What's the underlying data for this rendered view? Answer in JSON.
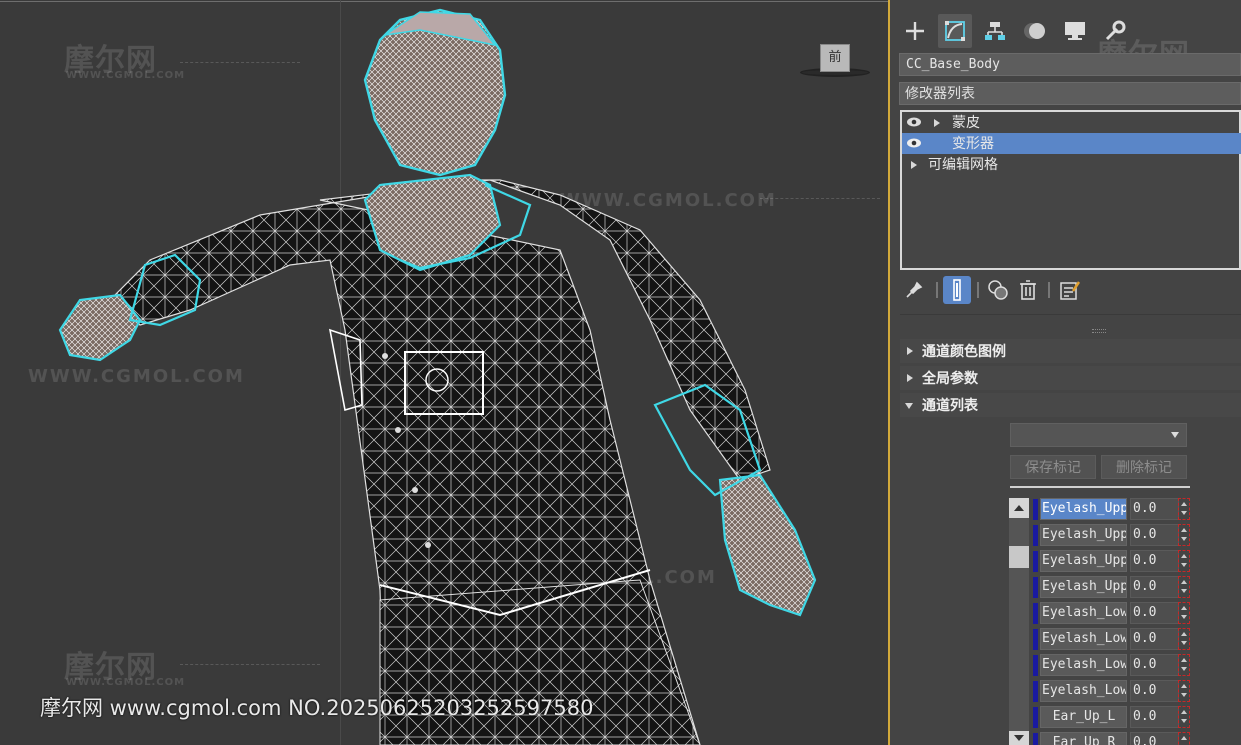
{
  "viewport": {
    "label": "前",
    "watermark_logo": "摩尔网",
    "watermark_sub": "WWW.CGMOL.COM",
    "watermark_url": "WWW.CGMOL.COM",
    "footer_text": "摩尔网 www.cgmol.com NO.20250625203252597580"
  },
  "panel": {
    "tabs": [
      "create-icon",
      "modify-icon",
      "hierarchy-icon",
      "motion-icon",
      "display-icon",
      "utilities-icon"
    ],
    "object_name": "CC_Base_Body",
    "modifier_list_label": "修改器列表",
    "stack": [
      {
        "label": "蒙皮",
        "visible": true,
        "expandable": true
      },
      {
        "label": "变形器",
        "visible": true,
        "selected": true
      },
      {
        "label": "可编辑网格",
        "expandable": true
      }
    ],
    "rollouts": [
      {
        "label": "通道颜色图例",
        "open": false
      },
      {
        "label": "全局参数",
        "open": false
      },
      {
        "label": "通道列表",
        "open": true
      }
    ],
    "save_marker_label": "保存标记",
    "delete_marker_label": "删除标记",
    "channels": [
      {
        "name": "Eyelash_Upp",
        "value": "0.0"
      },
      {
        "name": "Eyelash_Upp",
        "value": "0.0"
      },
      {
        "name": "Eyelash_Upp",
        "value": "0.0"
      },
      {
        "name": "Eyelash_Upp",
        "value": "0.0"
      },
      {
        "name": "Eyelash_Low",
        "value": "0.0"
      },
      {
        "name": "Eyelash_Low",
        "value": "0.0"
      },
      {
        "name": "Eyelash_Low",
        "value": "0.0"
      },
      {
        "name": "Eyelash_Low",
        "value": "0.0"
      },
      {
        "name": "Ear_Up_L",
        "value": "0.0"
      },
      {
        "name": "Ear_Up_R",
        "value": "0.0"
      }
    ]
  },
  "colors": {
    "selection": "#5a86c8",
    "viewport_border": "#d2a93a",
    "selection_outline": "#3fd8e6",
    "channel_bar": "#1a1aa0"
  }
}
